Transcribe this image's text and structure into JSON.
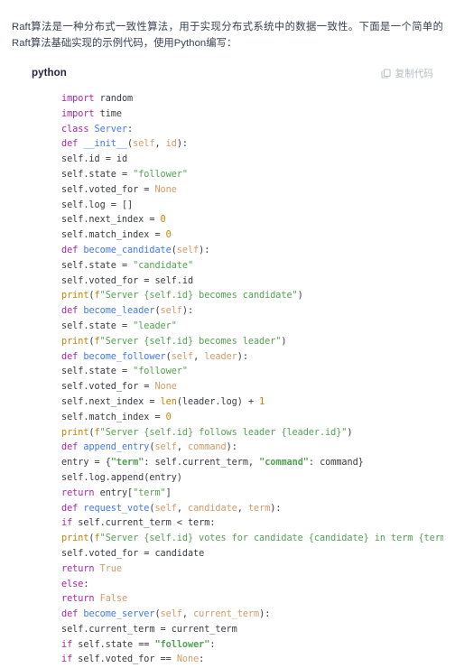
{
  "intro": {
    "paragraph": "Raft算法是一种分布式一致性算法，用于实现分布式系统中的数据一致性。下面是一个简单的Raft算法基础实现的示例代码，使用Python编写："
  },
  "code_block": {
    "language_label": "python",
    "copy_button": {
      "label": "复制代码",
      "icon": "copy-icon"
    },
    "colors": {
      "keyword": "#a626a4",
      "class_name": "#4078f2",
      "string": "#50a14f",
      "number": "#c18401",
      "constant": "#d19a66",
      "builtin": "#c18401",
      "plain": "#383a42",
      "background": "#ffffff",
      "lang_label": "#1f2340",
      "copy_label": "#b6bac2",
      "body_text": "#374151"
    },
    "lines": [
      "import random",
      "import time",
      "class Server:",
      "def __init__(self, id):",
      "self.id = id",
      "self.state = \"follower\"",
      "self.voted_for = None",
      "self.log = []",
      "self.next_index = 0",
      "self.match_index = 0",
      "def become_candidate(self):",
      "self.state = \"candidate\"",
      "self.voted_for = self.id",
      "print(f\"Server {self.id} becomes candidate\")",
      "def become_leader(self):",
      "self.state = \"leader\"",
      "print(f\"Server {self.id} becomes leader\")",
      "def become_follower(self, leader):",
      "self.state = \"follower\"",
      "self.voted_for = None",
      "self.next_index = len(leader.log) + 1",
      "self.match_index = 0",
      "print(f\"Server {self.id} follows leader {leader.id}\")",
      "def append_entry(self, command):",
      "entry = {\"term\": self.current_term, \"command\": command}",
      "self.log.append(entry)",
      "return entry[\"term\"]",
      "def request_vote(self, candidate, term):",
      "if self.current_term < term:",
      "print(f\"Server {self.id} votes for candidate {candidate} in term {term}\")",
      "self.voted_for = candidate",
      "return True",
      "else:",
      "return False",
      "def become_server(self, current_term):",
      "self.current_term = current_term",
      "if self.state == \"follower\":",
      "if self.voted_for == None:"
    ]
  }
}
